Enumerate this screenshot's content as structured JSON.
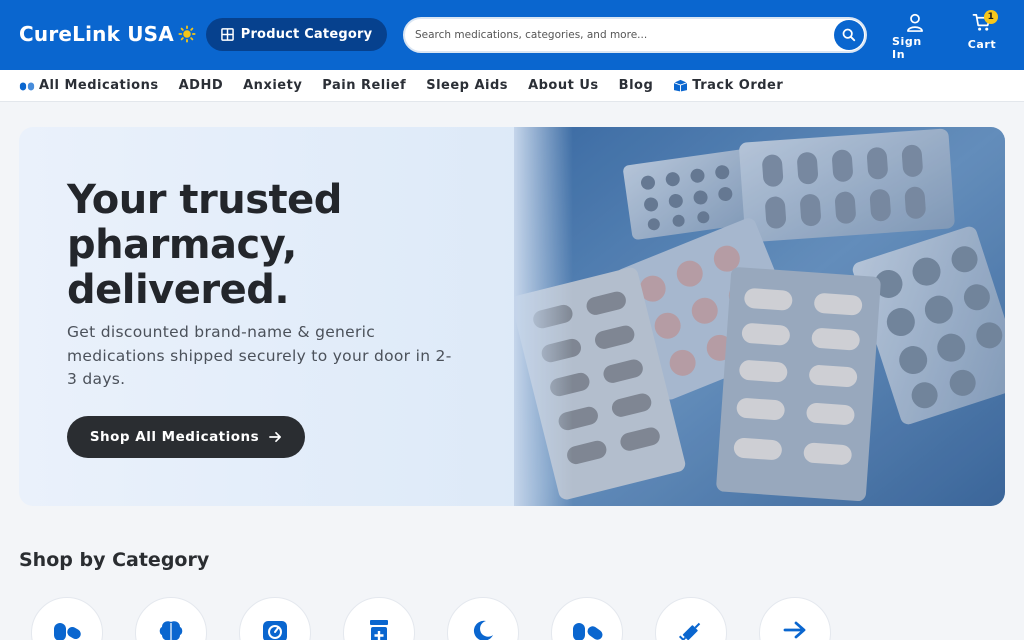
{
  "header": {
    "logo_text": "CureLink USA",
    "category_button_label": "Product Category",
    "search_placeholder": "Search medications, categories, and more...",
    "signin_label": "Sign In",
    "cart_label": "Cart",
    "cart_count": "1"
  },
  "nav": {
    "items": [
      {
        "label": "All Medications",
        "icon": "pills-icon"
      },
      {
        "label": "ADHD"
      },
      {
        "label": "Anxiety"
      },
      {
        "label": "Pain Relief"
      },
      {
        "label": "Sleep Aids"
      },
      {
        "label": "About Us"
      },
      {
        "label": "Blog"
      },
      {
        "label": "Track Order",
        "icon": "box-icon"
      }
    ]
  },
  "hero": {
    "title_line1": "Your trusted",
    "title_line2": "pharmacy,",
    "title_line3": "delivered.",
    "subtitle": "Get discounted brand-name & generic medications shipped securely to your door in 2-3 days.",
    "cta_label": "Shop All Medications",
    "image": "blister-packs-photo"
  },
  "categories": {
    "title": "Shop by Category",
    "icons": [
      "pills-icon",
      "brain-icon",
      "gauge-icon",
      "medicine-bottle-icon",
      "moon-icon",
      "capsules-icon",
      "syringe-icon",
      "arrow-right-icon"
    ]
  },
  "colors": {
    "brand_blue": "#0a66cf",
    "dark_button": "#2a2d31",
    "badge_yellow": "#f7c71b"
  }
}
